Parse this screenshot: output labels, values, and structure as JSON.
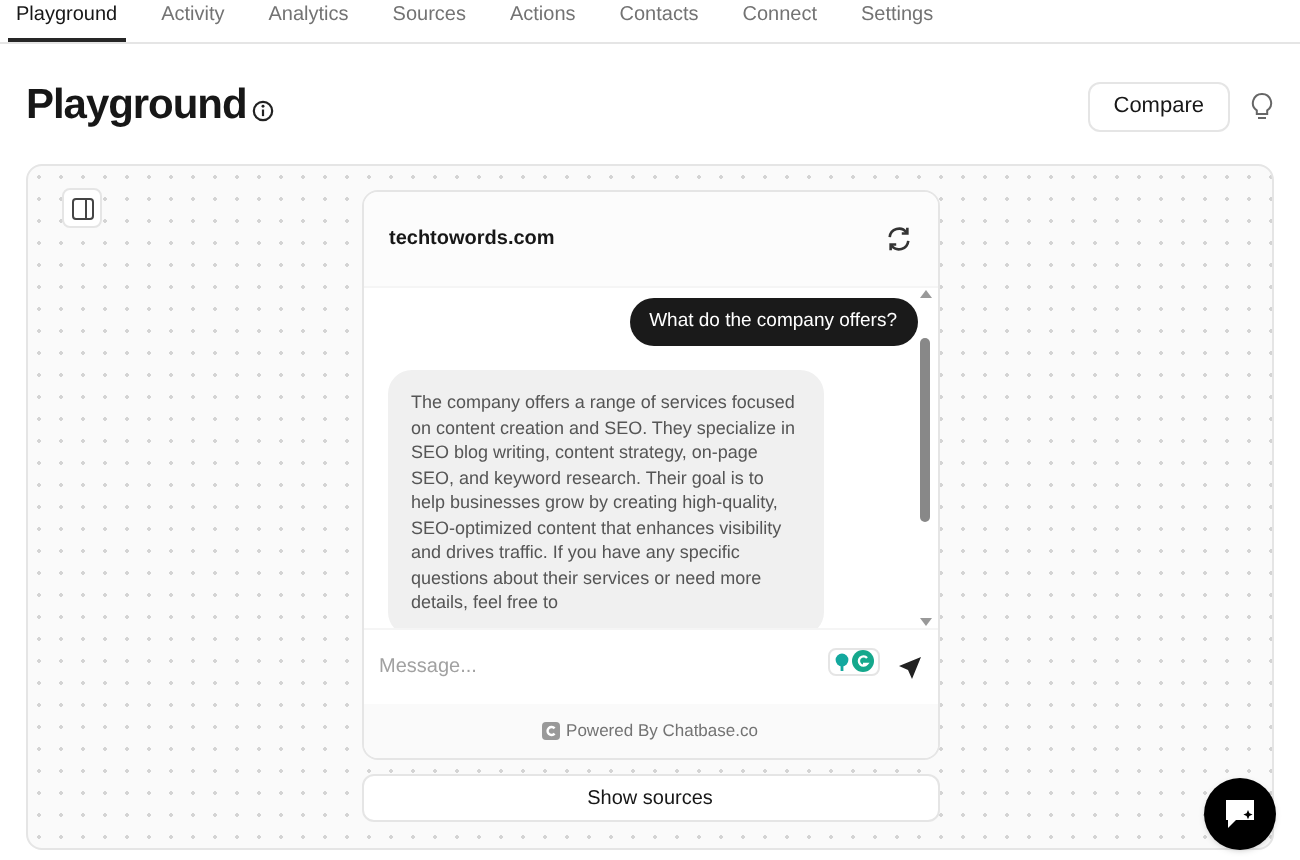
{
  "tabs": [
    {
      "label": "Playground",
      "selected": true
    },
    {
      "label": "Activity",
      "selected": false
    },
    {
      "label": "Analytics",
      "selected": false
    },
    {
      "label": "Sources",
      "selected": false
    },
    {
      "label": "Actions",
      "selected": false
    },
    {
      "label": "Contacts",
      "selected": false
    },
    {
      "label": "Connect",
      "selected": false
    },
    {
      "label": "Settings",
      "selected": false
    }
  ],
  "page_title": "Playground",
  "compare_button": "Compare",
  "chat": {
    "title": "techtowords.com",
    "messages": [
      {
        "kind": "user",
        "text": "What do the company offers?"
      },
      {
        "kind": "bot",
        "text": "The company offers a range of services focused on content creation and SEO. They specialize in SEO blog writing, content strategy, on-page SEO, and keyword research. Their goal is to help businesses grow by creating high-quality, SEO-optimized content that enhances visibility and drives traffic. If you have any specific questions about their services or need more details, feel free to"
      }
    ],
    "input": {
      "placeholder": "Message..."
    },
    "footer": "Powered By Chatbase.co"
  },
  "show_sources_button": "Show sources"
}
